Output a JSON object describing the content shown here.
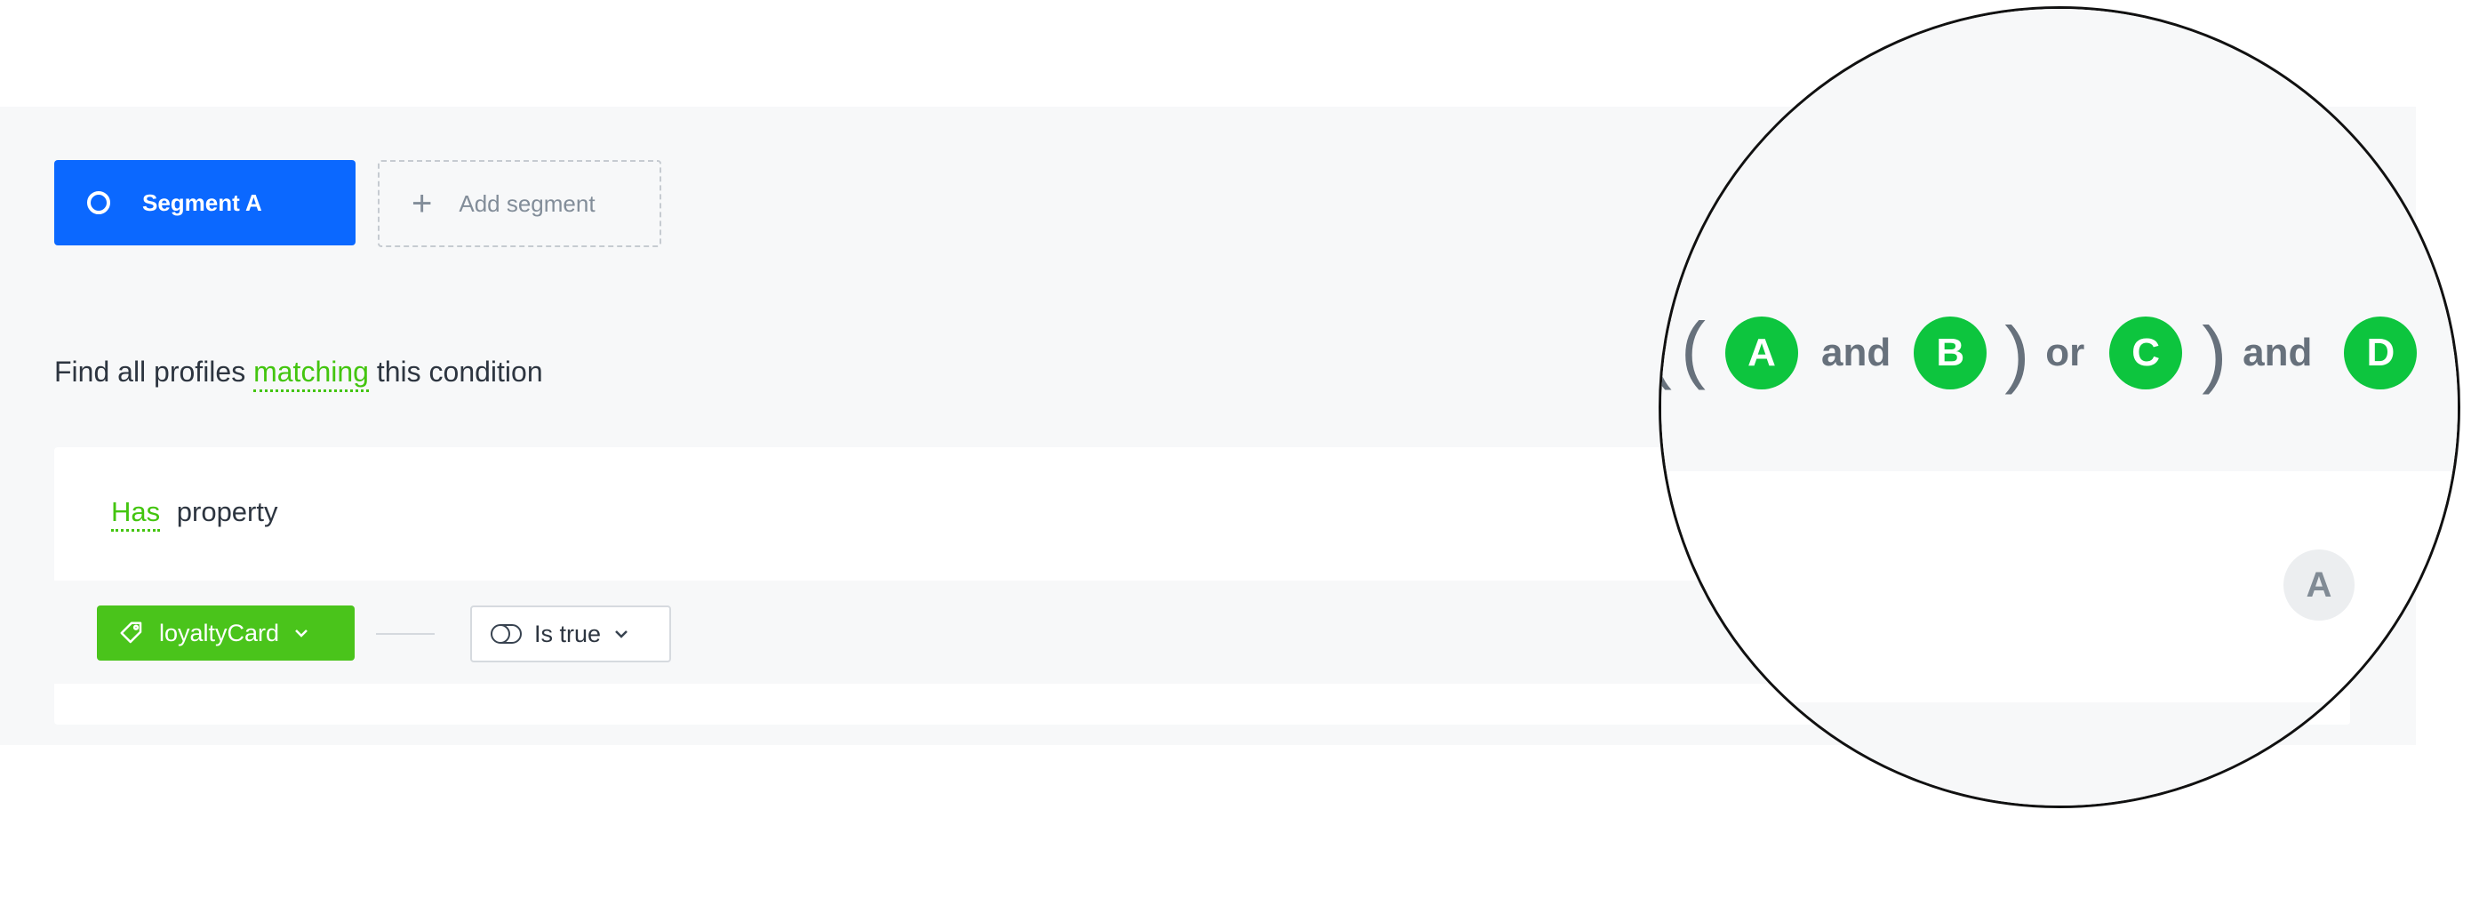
{
  "segments": {
    "active_label": "Segment A",
    "add_label": "Add segment"
  },
  "condition_header": {
    "prefix": "Find all profiles",
    "match_mode": "matching",
    "suffix": "this condition"
  },
  "condition": {
    "has_label": "Has",
    "type_label": "property",
    "property_name": "loyaltyCard",
    "operator_label": "Is true",
    "property_icon": "tag-icon",
    "operator_icon": "toggle-icon"
  },
  "expression": {
    "open_paren_1": "(",
    "open_paren_2": "(",
    "chip_a": "A",
    "and_1": "and",
    "chip_b": "B",
    "close_paren_1": ")",
    "or_1": "or",
    "chip_c": "C",
    "close_paren_2": ")",
    "and_2": "and",
    "chip_d": "D"
  },
  "condition_badge": "A",
  "colors": {
    "primary": "#0b68ff",
    "success": "#4ac41b",
    "chip": "#0dc53e",
    "background": "#f7f8f9"
  }
}
